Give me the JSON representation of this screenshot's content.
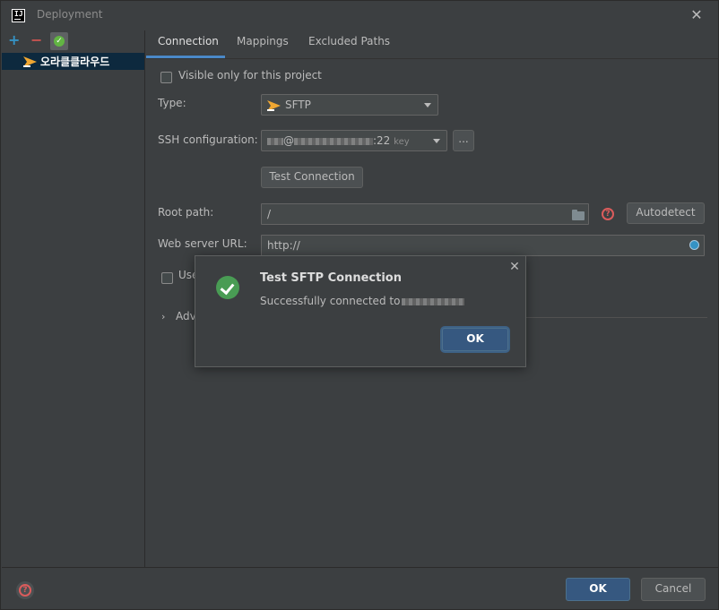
{
  "window": {
    "title": "Deployment",
    "app_icon_text": "IJ"
  },
  "left_panel": {
    "toolbar": {
      "add": "+",
      "remove": "−",
      "default": "✓"
    },
    "servers": [
      {
        "label": "오라클클라우드",
        "selected": true
      }
    ]
  },
  "tabs": [
    {
      "label": "Connection",
      "active": true
    },
    {
      "label": "Mappings",
      "active": false
    },
    {
      "label": "Excluded Paths",
      "active": false
    }
  ],
  "connection": {
    "visible_only_label": "Visible only for this project",
    "visible_only_checked": false,
    "type_label": "Type:",
    "type_value": "SFTP",
    "ssh_label": "SSH configuration:",
    "ssh_value_host": "@",
    "ssh_value_port": ":22",
    "ssh_value_auth": "key",
    "ssh_more": "...",
    "test_connection": "Test Connection",
    "root_path_label": "Root path:",
    "root_path_value": "/",
    "autodetect": "Autodetect",
    "web_url_label": "Web server URL:",
    "web_url_value": "http://",
    "use_label": "Use",
    "advanced_label": "Adv"
  },
  "dialog": {
    "title": "Test SFTP Connection",
    "message": "Successfully connected to",
    "ok": "OK",
    "close": "✕"
  },
  "footer": {
    "ok": "OK",
    "cancel": "Cancel"
  },
  "colors": {
    "background": "#3c3f41",
    "accent": "#4a88c7",
    "primary_button": "#365880",
    "success": "#499c54",
    "error": "#db5c5c",
    "selection": "#0d293e"
  }
}
